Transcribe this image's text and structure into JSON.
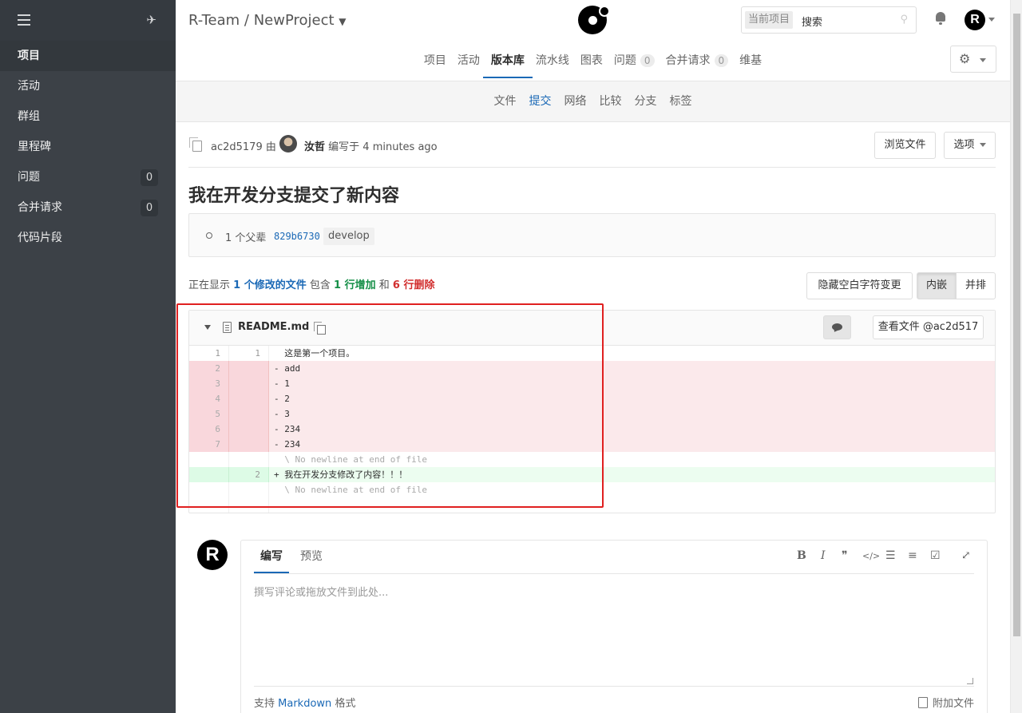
{
  "sidebar": {
    "items": [
      {
        "label": "项目",
        "active": true
      },
      {
        "label": "活动"
      },
      {
        "label": "群组"
      },
      {
        "label": "里程碑"
      },
      {
        "label": "问题",
        "count": "0"
      },
      {
        "label": "合并请求",
        "count": "0"
      },
      {
        "label": "代码片段"
      }
    ]
  },
  "header": {
    "breadcrumb": "R-Team / NewProject",
    "search_scope": "当前项目",
    "search_placeholder": "搜索",
    "user_initial": "R",
    "tabs": [
      {
        "label": "项目"
      },
      {
        "label": "活动"
      },
      {
        "label": "版本库",
        "active": true
      },
      {
        "label": "流水线"
      },
      {
        "label": "图表"
      },
      {
        "label": "问题",
        "badge": "0"
      },
      {
        "label": "合并请求",
        "badge": "0"
      },
      {
        "label": "维基"
      }
    ]
  },
  "subnav": {
    "items": [
      {
        "label": "文件"
      },
      {
        "label": "提交",
        "active": true
      },
      {
        "label": "网络"
      },
      {
        "label": "比较"
      },
      {
        "label": "分支"
      },
      {
        "label": "标签"
      }
    ]
  },
  "commit": {
    "sha": "ac2d5179",
    "by": "由",
    "author": "汝哲",
    "authored": "编写于 4 minutes ago",
    "browse_files": "浏览文件",
    "options": "选项",
    "title": "我在开发分支提交了新内容",
    "parent_label": "1 个父辈",
    "parent_sha": "829b6730",
    "branch": "develop"
  },
  "stats": {
    "prefix": "正在显示",
    "files": "1 个修改的文件",
    "mid": "包含",
    "additions": "1 行增加",
    "and": "和",
    "deletions": "6 行删除"
  },
  "view_toggle": {
    "hide_whitespace": "隐藏空白字符变更",
    "inline": "内嵌",
    "side_by_side": "并排"
  },
  "file": {
    "name": "README.md",
    "view_file": "查看文件 @ac2d517",
    "lines": [
      {
        "type": "ctx",
        "old": "1",
        "new": "1",
        "text": "  这是第一个项目。"
      },
      {
        "type": "del",
        "old": "2",
        "new": "",
        "text": "- add"
      },
      {
        "type": "del",
        "old": "3",
        "new": "",
        "text": "- 1"
      },
      {
        "type": "del",
        "old": "4",
        "new": "",
        "text": "- 2"
      },
      {
        "type": "del",
        "old": "5",
        "new": "",
        "text": "- 3"
      },
      {
        "type": "del",
        "old": "6",
        "new": "",
        "text": "- 234"
      },
      {
        "type": "del",
        "old": "7",
        "new": "",
        "text": "- 234"
      },
      {
        "type": "meta",
        "old": "",
        "new": "",
        "text": "  \\ No newline at end of file"
      },
      {
        "type": "add",
        "old": "",
        "new": "2",
        "text": "+ 我在开发分支修改了内容！！！"
      },
      {
        "type": "meta",
        "old": "",
        "new": "",
        "text": "  \\ No newline at end of file"
      },
      {
        "type": "ctx",
        "old": "",
        "new": "",
        "text": ""
      }
    ]
  },
  "editor": {
    "user_initial": "R",
    "tab_write": "编写",
    "tab_preview": "预览",
    "placeholder": "撰写评论或拖放文件到此处...",
    "markdown_prefix": "支持",
    "markdown_link": "Markdown",
    "markdown_suffix": "格式",
    "attach": "附加文件",
    "tools": [
      "B",
      "I",
      "❞",
      "</>",
      "☰",
      "≡",
      "☑",
      "⤢"
    ]
  }
}
